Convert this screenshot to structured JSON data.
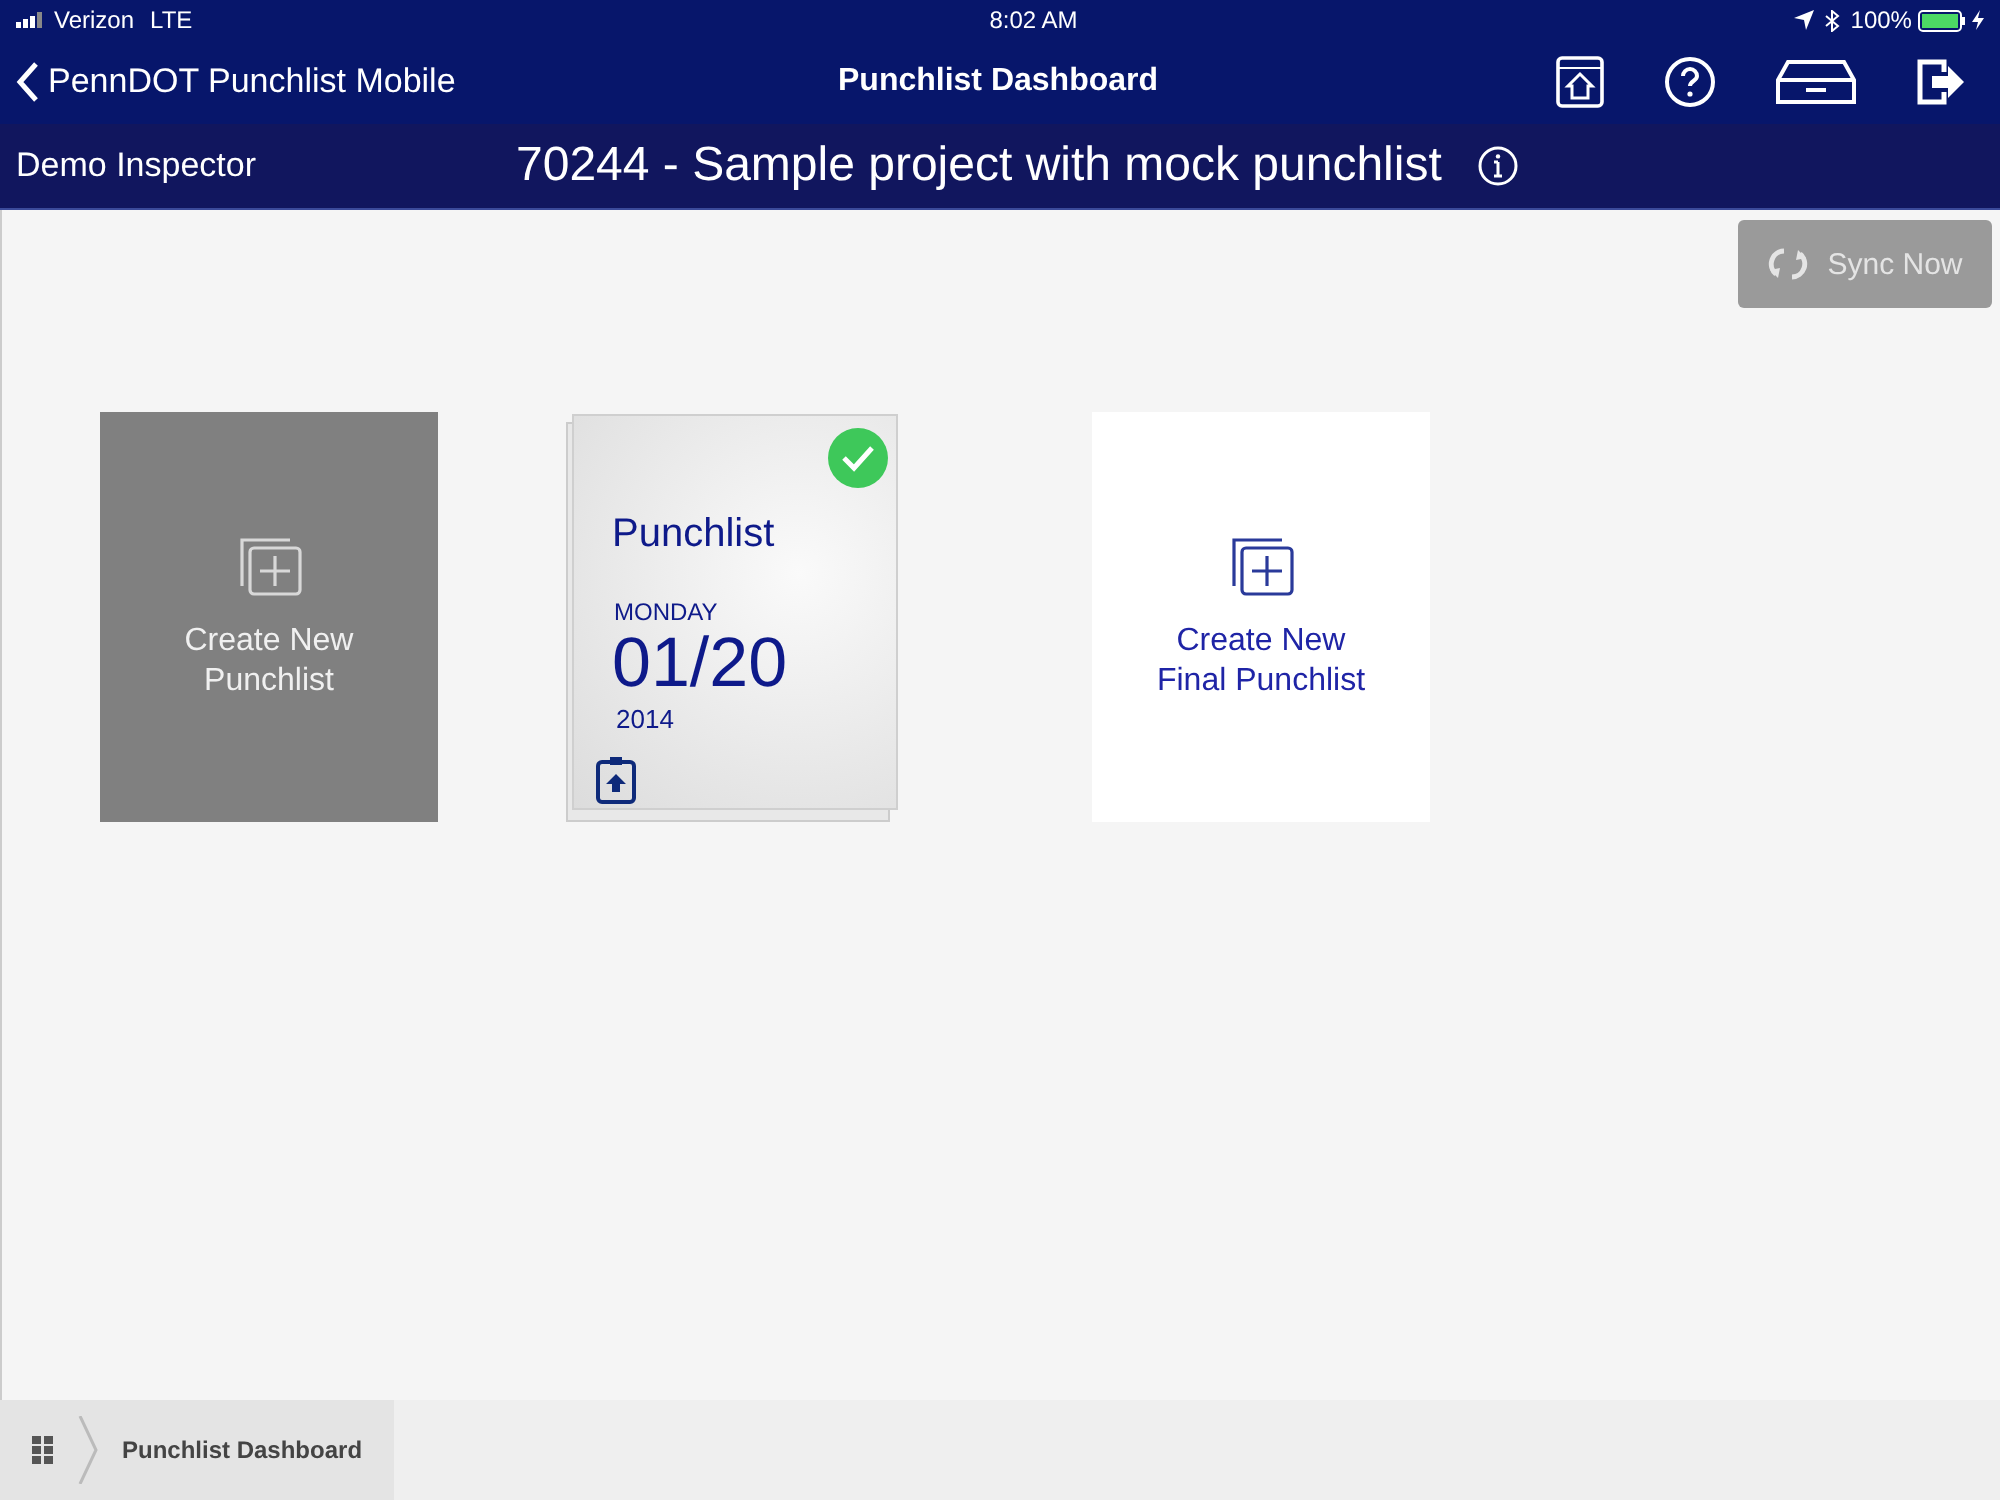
{
  "status_bar": {
    "carrier": "Verizon",
    "network": "LTE",
    "time": "8:02 AM",
    "battery": "100%"
  },
  "nav_bar": {
    "back_label": "PennDOT Punchlist Mobile",
    "title": "Punchlist Dashboard"
  },
  "project_bar": {
    "user": "Demo Inspector",
    "project": "70244 - Sample project with mock punchlist"
  },
  "sync_button": {
    "label": "Sync Now",
    "disabled": true
  },
  "tiles": [
    {
      "kind": "create",
      "lines": [
        "Create New",
        "Punchlist"
      ]
    },
    {
      "kind": "punchlist",
      "title": "Punchlist",
      "weekday": "MONDAY",
      "date": "01/20",
      "year": "2014",
      "completed": true
    },
    {
      "kind": "create_final",
      "lines": [
        "Create New",
        "Final Punchlist"
      ]
    }
  ],
  "breadcrumb": {
    "items": [
      "Punchlist Dashboard"
    ]
  }
}
